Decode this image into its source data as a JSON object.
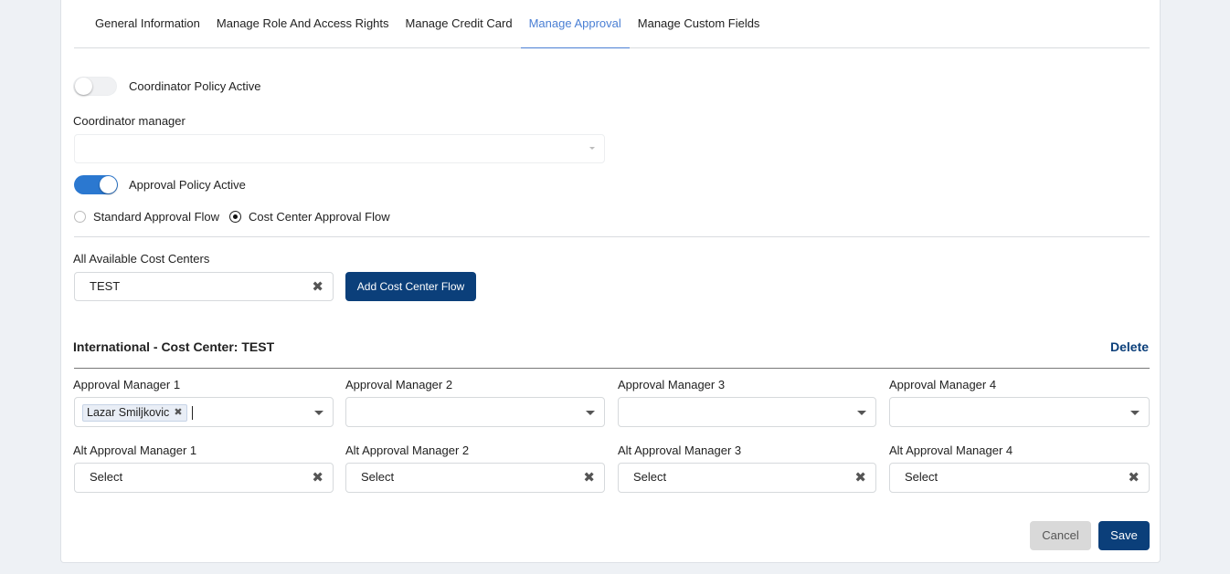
{
  "tabs": [
    {
      "label": "General Information",
      "active": false
    },
    {
      "label": "Manage Role And Access Rights",
      "active": false
    },
    {
      "label": "Manage Credit Card",
      "active": false
    },
    {
      "label": "Manage Approval",
      "active": true
    },
    {
      "label": "Manage Custom Fields",
      "active": false
    }
  ],
  "coordinator": {
    "toggle_label": "Coordinator Policy Active",
    "toggle_on": false,
    "manager_label": "Coordinator manager",
    "manager_value": ""
  },
  "approval": {
    "toggle_label": "Approval Policy Active",
    "toggle_on": true,
    "flow_options": [
      {
        "label": "Standard Approval Flow",
        "checked": false
      },
      {
        "label": "Cost Center Approval Flow",
        "checked": true
      }
    ]
  },
  "cost_centers": {
    "label": "All Available Cost Centers",
    "selected": "TEST",
    "clear_icon": "x-icon",
    "add_button": "Add Cost Center Flow"
  },
  "flow_section": {
    "title": "International - Cost Center: TEST",
    "delete_label": "Delete",
    "managers": [
      {
        "label": "Approval Manager 1",
        "chips": [
          "Lazar Smiljkovic"
        ]
      },
      {
        "label": "Approval Manager 2",
        "chips": []
      },
      {
        "label": "Approval Manager 3",
        "chips": []
      },
      {
        "label": "Approval Manager 4",
        "chips": []
      }
    ],
    "alt_managers": [
      {
        "label": "Alt Approval Manager 1",
        "value": "Select"
      },
      {
        "label": "Alt Approval Manager 2",
        "value": "Select"
      },
      {
        "label": "Alt Approval Manager 3",
        "value": "Select"
      },
      {
        "label": "Alt Approval Manager 4",
        "value": "Select"
      }
    ]
  },
  "footer": {
    "cancel_label": "Cancel",
    "save_label": "Save"
  },
  "colors": {
    "accent": "#4a7fd4",
    "primary_button": "#0b3f7a",
    "toggle_on": "#2b78d0",
    "cancel_button": "#d9d9d9"
  }
}
